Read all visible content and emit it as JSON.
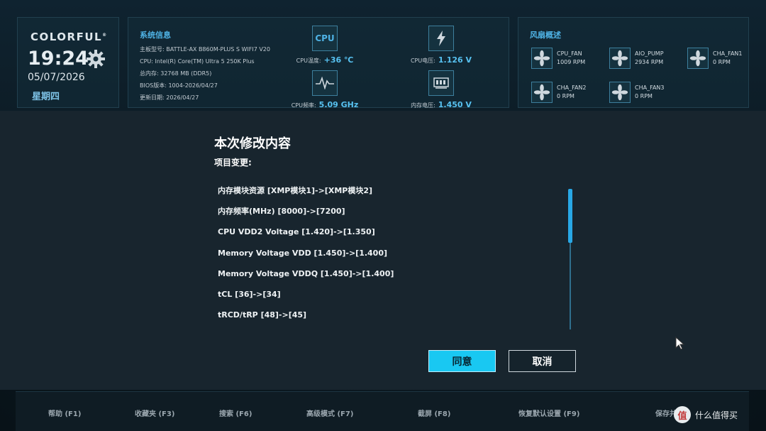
{
  "brand": {
    "name": "COLORFUL",
    "mark": "®"
  },
  "clock": {
    "time": "19:24",
    "date": "05/07/2026",
    "weekday": "星期四"
  },
  "system": {
    "title": "系统信息",
    "rows": [
      {
        "key": "主板型号:",
        "value": "BATTLE-AX B860M-PLUS S WIFI7 V20"
      },
      {
        "key": "CPU:",
        "value": "Intel(R) Core(TM) Ultra 5 250K Plus"
      },
      {
        "key": "总内存:",
        "value": "32768 MB (DDR5)"
      },
      {
        "key": "BIOS版本:",
        "value": "1004-2026/04/27"
      },
      {
        "key": "更新日期:",
        "value": "2026/04/27"
      }
    ],
    "stats": [
      {
        "icon_label": "CPU",
        "label": "CPU温度:",
        "value": "+36 ℃"
      },
      {
        "icon_label": "",
        "label": "CPU电压:",
        "value": "1.126 V"
      },
      {
        "icon_label": "",
        "label": "CPU频率:",
        "value": "5.09 GHz"
      },
      {
        "icon_label": "",
        "label": "内存电压:",
        "value": "1.450 V"
      }
    ]
  },
  "fans": {
    "title": "风扇概述",
    "items": [
      {
        "name": "CPU_FAN",
        "rpm": "1009 RPM"
      },
      {
        "name": "AIO_PUMP",
        "rpm": "2934 RPM"
      },
      {
        "name": "CHA_FAN1",
        "rpm": "0 RPM"
      },
      {
        "name": "CHA_FAN2",
        "rpm": "0 RPM"
      },
      {
        "name": "CHA_FAN3",
        "rpm": "0 RPM"
      }
    ]
  },
  "dialog": {
    "title": "本次修改内容",
    "subtitle": "项目变更:",
    "changes": [
      "内存模块资源 [XMP模块1]->[XMP模块2]",
      "内存频率(MHz) [8000]->[7200]",
      "CPU VDD2 Voltage [1.420]->[1.350]",
      "Memory Voltage VDD [1.450]->[1.400]",
      "Memory Voltage VDDQ [1.450]->[1.400]",
      "tCL [36]->[34]",
      "tRCD/tRP [48]->[45]"
    ],
    "scroll_position": 0.0,
    "ok_label": "同意",
    "cancel_label": "取消"
  },
  "footer": {
    "items": [
      "帮助 (F1)",
      "收藏夹 (F3)",
      "搜索 (F6)",
      "高级模式 (F7)",
      "截屏 (F8)",
      "恢复默认设置 (F9)",
      "保存并退出"
    ]
  },
  "watermark": {
    "logo": "值",
    "text": "什么值得买"
  },
  "colors": {
    "accent": "#19c8f2",
    "title_blue": "#4fb3e6",
    "value_blue": "#57c1f0"
  }
}
